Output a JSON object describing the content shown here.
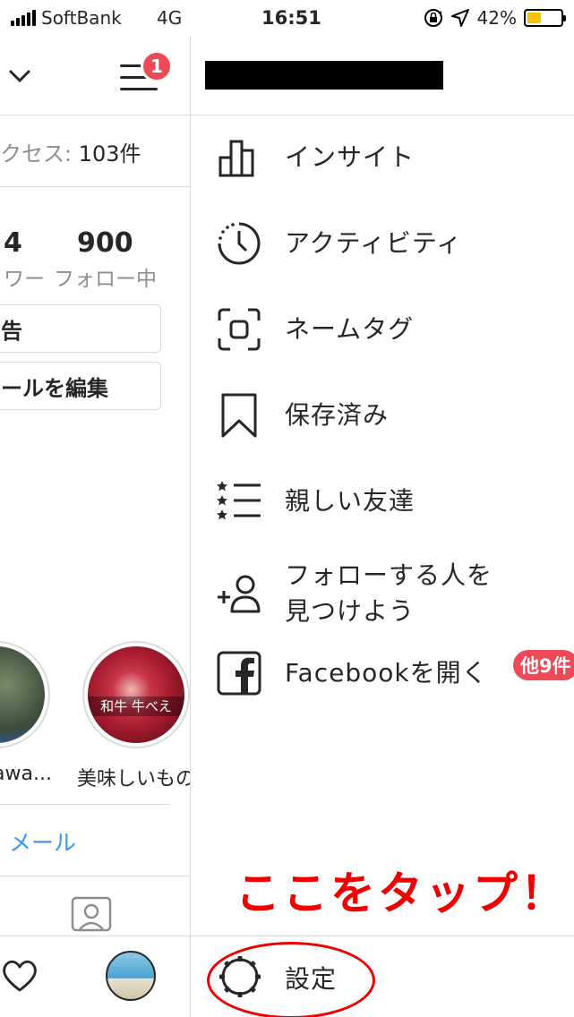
{
  "status_bar": {
    "carrier": "SoftBank",
    "network": "4G",
    "time": "16:51",
    "battery": "42%",
    "battery_level": 0.42,
    "icons": [
      "signal-icon",
      "rotation-lock-icon",
      "location-arrow-icon",
      "battery-icon"
    ]
  },
  "profile": {
    "notification_count": "1",
    "access_label": "クセス: ",
    "access_value": "103件",
    "followers_count": "4",
    "followers_label": "ワー",
    "following_count": "900",
    "following_label": "フォロー中",
    "ad_button_label": "告",
    "edit_profile_label": "ールを編集",
    "highlights": [
      {
        "label": "awa..."
      },
      {
        "label": "美味しいもの",
        "overlay_text": "和牛 牛べえ"
      }
    ],
    "mail_label": "メール"
  },
  "drawer": {
    "menu": [
      {
        "label": "インサイト",
        "icon": "insights-icon"
      },
      {
        "label": "アクティビティ",
        "icon": "activity-icon"
      },
      {
        "label": "ネームタグ",
        "icon": "nametag-icon"
      },
      {
        "label": "保存済み",
        "icon": "bookmark-icon"
      },
      {
        "label": "親しい友達",
        "icon": "close-friends-icon"
      },
      {
        "label_line1": "フォローする人を",
        "label_line2": "見つけよう",
        "icon": "add-person-icon"
      },
      {
        "label": "Facebookを開く",
        "icon": "facebook-icon",
        "badge": "他9件"
      }
    ],
    "annotation": "ここをタップ！",
    "settings_label": "設定"
  },
  "colors": {
    "accent_red": "#ed4956",
    "annotation_red": "#ee0000",
    "link_blue": "#3897f0",
    "battery_yellow": "#f5c400"
  }
}
